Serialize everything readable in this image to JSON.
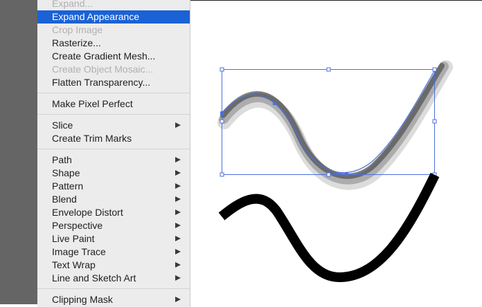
{
  "menu": {
    "group1": [
      {
        "label": "Expand...",
        "disabled": true,
        "submenu": false
      },
      {
        "label": "Expand Appearance",
        "highlighted": true,
        "submenu": false
      },
      {
        "label": "Crop Image",
        "disabled": true,
        "submenu": false
      },
      {
        "label": "Rasterize...",
        "submenu": false
      },
      {
        "label": "Create Gradient Mesh...",
        "submenu": false
      },
      {
        "label": "Create Object Mosaic...",
        "disabled": true,
        "submenu": false
      },
      {
        "label": "Flatten Transparency...",
        "submenu": false
      }
    ],
    "group2": [
      {
        "label": "Make Pixel Perfect",
        "submenu": false
      }
    ],
    "group3": [
      {
        "label": "Slice",
        "submenu": true
      },
      {
        "label": "Create Trim Marks",
        "submenu": false
      }
    ],
    "group4": [
      {
        "label": "Path",
        "submenu": true
      },
      {
        "label": "Shape",
        "submenu": true
      },
      {
        "label": "Pattern",
        "submenu": true
      },
      {
        "label": "Blend",
        "submenu": true
      },
      {
        "label": "Envelope Distort",
        "submenu": true
      },
      {
        "label": "Perspective",
        "submenu": true
      },
      {
        "label": "Live Paint",
        "submenu": true
      },
      {
        "label": "Image Trace",
        "submenu": true
      },
      {
        "label": "Text Wrap",
        "submenu": true
      },
      {
        "label": "Line and Sketch Art",
        "submenu": true
      }
    ],
    "group5": [
      {
        "label": "Clipping Mask",
        "submenu": true
      }
    ]
  },
  "colors": {
    "highlight": "#1a62d6",
    "selection": "#4a6fe0",
    "workspace_gray": "#656565",
    "stroke_black": "#000000"
  },
  "icons": {
    "submenu": "submenu-arrow-icon"
  }
}
